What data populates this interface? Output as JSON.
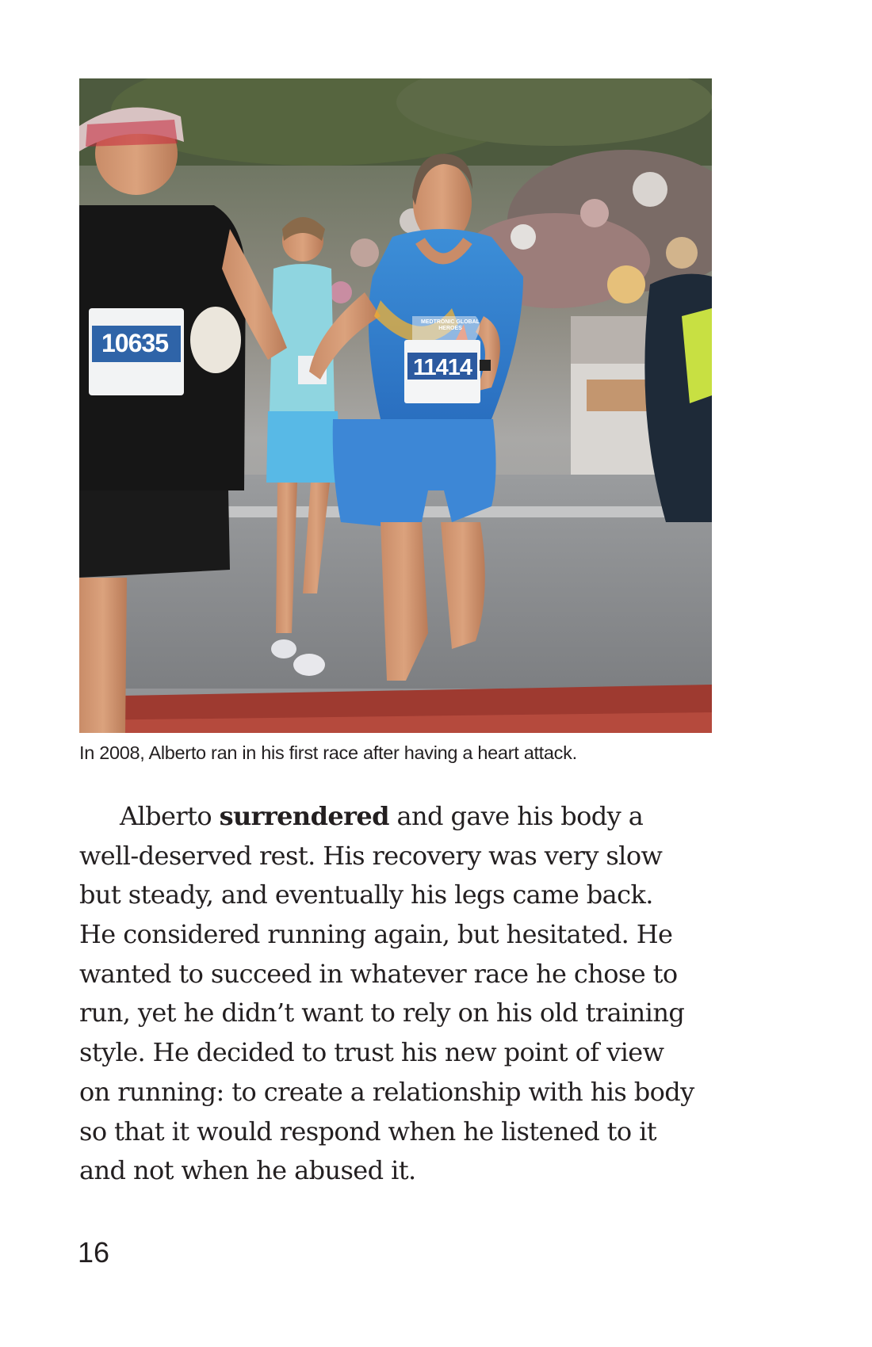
{
  "photo": {
    "bib_left": "10635",
    "bib_center": "11414",
    "singlet_text": "MEDTRONIC GLOBAL HEROES"
  },
  "caption": "In 2008, Alberto ran in his first race after having a heart attack.",
  "paragraph": {
    "line1_pre": "Alberto ",
    "line1_bold": "surrendered",
    "line1_post": " and gave his body a",
    "lines": [
      "well-deserved rest. His recovery was very slow",
      "but steady, and eventually his legs came back.",
      "He considered running again, but hesitated. He",
      "wanted to succeed in whatever race he chose to",
      "run, yet he didn’t want to rely on his old training",
      "style. He decided to trust his new point of view",
      "on running: to create a relationship with his body",
      "so that it would respond when he listened to it",
      "and not when he abused it."
    ]
  },
  "page_number": "16"
}
